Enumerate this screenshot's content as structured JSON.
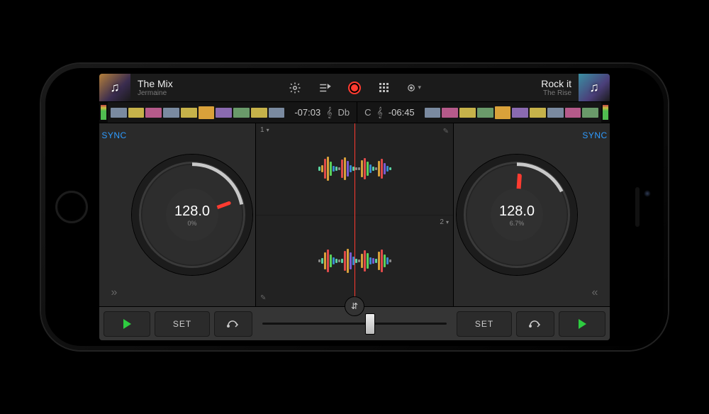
{
  "deckA": {
    "title": "The Mix",
    "artist": "Jermaine",
    "time": "-07:03",
    "key": "Db",
    "bpm": "128.0",
    "pct": "0%",
    "sync": "SYNC"
  },
  "deckB": {
    "title": "Rock it",
    "artist": "The Rise",
    "time": "-06:45",
    "key": "C",
    "bpm": "128.0",
    "pct": "6.7%",
    "sync": "SYNC"
  },
  "waveform": {
    "labelA": "1",
    "labelB": "2"
  },
  "controls": {
    "set": "SET",
    "chevL": "»",
    "chevR": "«"
  },
  "colors": {
    "accent": "#ff3b30",
    "play": "#2ecc40",
    "sync": "#2e9bff"
  }
}
